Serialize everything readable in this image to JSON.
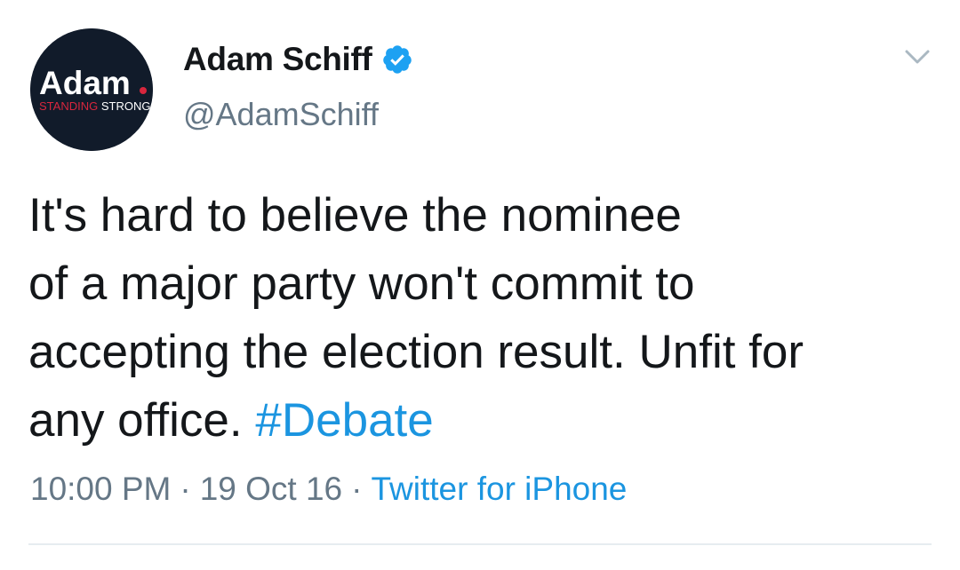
{
  "author": {
    "display_name": "Adam Schiff",
    "handle": "@AdamSchiff",
    "verified": true,
    "avatar": {
      "logo_text": "Adam",
      "tagline_red": "STANDING",
      "tagline_white": " STRONG",
      "background_color": "#111b2a",
      "accent_color": "#d7263d"
    }
  },
  "tweet": {
    "text_lines": [
      "It's hard to believe the nominee",
      "of a major party won't commit to",
      "accepting the election result. Unfit for",
      "any office. "
    ],
    "hashtag": "#Debate",
    "time": "10:00 PM",
    "date": "19 Oct 16",
    "separator": "·",
    "source": "Twitter for iPhone"
  },
  "colors": {
    "link": "#1b95e0",
    "secondary_text": "#657786",
    "primary_text": "#14171a",
    "verified_badge": "#1da1f2",
    "divider": "#e6ecf0"
  },
  "icons": {
    "verified": "verified-badge-icon",
    "menu": "chevron-down-icon"
  }
}
